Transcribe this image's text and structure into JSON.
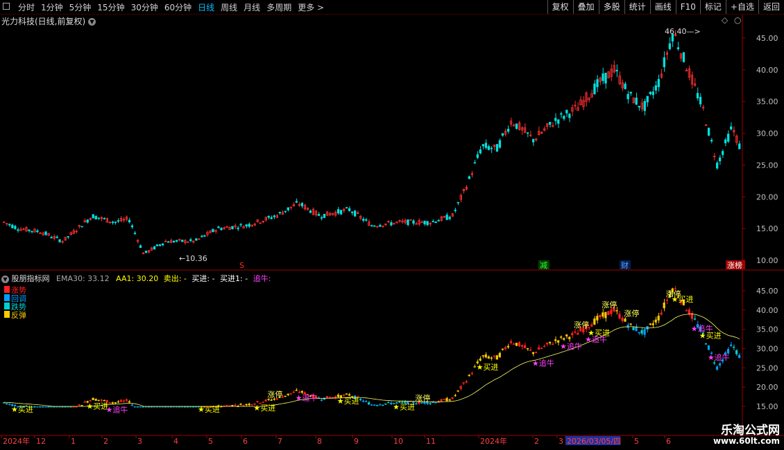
{
  "toolbar": {
    "tabs": [
      "分时",
      "1分钟",
      "5分钟",
      "15分钟",
      "30分钟",
      "60分钟",
      "日线",
      "周线",
      "月线",
      "多周期",
      "更多 >"
    ],
    "active_tab": "日线",
    "right_buttons": [
      "复权",
      "叠加",
      "多股",
      "统计",
      "画线",
      "F10",
      "标记",
      "+自选",
      "返回"
    ]
  },
  "main_chart": {
    "title": "光力科技(日线,前复权)",
    "price_labels": [
      "45.00",
      "40.00",
      "35.00",
      "30.00",
      "25.00",
      "20.00",
      "15.00",
      "10.00"
    ],
    "high_label": "46.40",
    "low_label": "10.36",
    "event_badges": [
      "S",
      "减",
      "财",
      "涨榜"
    ]
  },
  "indicator": {
    "title": "股朋指标网",
    "values": {
      "ema30_label": "EMA30: 33.12",
      "aa1_label": "AA1: 30.20",
      "sell_label": "卖出: -",
      "buy_label": "买进: -",
      "buy1_label": "买进1: -",
      "chase_label": "追牛:"
    },
    "legend": [
      {
        "label": "涨势",
        "color": "#ff2020"
      },
      {
        "label": "回调",
        "color": "#00a0ff"
      },
      {
        "label": "跌势",
        "color": "#00d0d0"
      },
      {
        "label": "反弹",
        "color": "#ffcc00"
      }
    ],
    "price_labels": [
      "45.00",
      "40.00",
      "35.00",
      "30.00",
      "25.00",
      "20.00",
      "15.00"
    ],
    "annotations": {
      "buy": "买进",
      "limit_up": "涨停",
      "chase": "追牛"
    }
  },
  "time_axis": {
    "labels": [
      "2024年",
      "12",
      "1",
      "2",
      "3",
      "4",
      "5",
      "6",
      "7",
      "8",
      "9",
      "10",
      "11",
      "2024年",
      "2",
      "3",
      "2026/03/05/四",
      "5",
      "6"
    ]
  },
  "watermark": {
    "name": "乐淘公式网",
    "url": "www.60lt.com"
  },
  "colors": {
    "up": "#ff3030",
    "down": "#00e0e0",
    "axis": "#a00000",
    "ema": "#ffff60",
    "buy": "#ffff00",
    "chase": "#ff40ff"
  }
}
